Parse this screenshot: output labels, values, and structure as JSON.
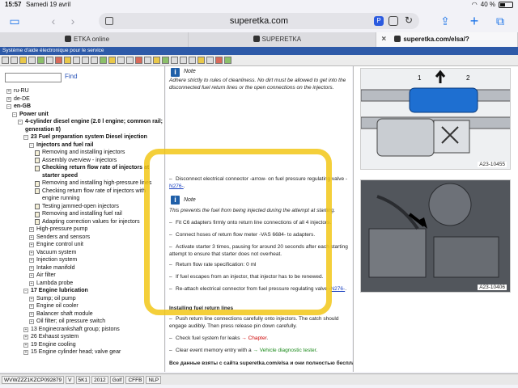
{
  "status": {
    "time": "15:57",
    "date": "Samedi 19 avril",
    "battery": "40 %"
  },
  "browser": {
    "url": "superetka.com",
    "tabs": [
      {
        "label": "ETKA online",
        "active": false
      },
      {
        "label": "SUPERETKA",
        "active": false
      },
      {
        "label": "superetka.com/elsa/?marke=V&modelljahr_num...",
        "active": true
      }
    ]
  },
  "app": {
    "title": "Système d'aide électronique pour le service",
    "find_label": "Find"
  },
  "tree": [
    {
      "label": "ru-RU",
      "toggle": "+",
      "indent": 0
    },
    {
      "label": "de-DE",
      "toggle": "+",
      "indent": 0
    },
    {
      "label": "en-GB",
      "toggle": "−",
      "indent": 0,
      "bold": true
    },
    {
      "label": "Power unit",
      "toggle": "−",
      "indent": 1,
      "bold": true
    },
    {
      "label": "4-cylinder diesel engine (2.0 l engine; common rail;",
      "toggle": "−",
      "indent": 2,
      "bold": true
    },
    {
      "label": "generation II)",
      "indent": 2,
      "bold": true,
      "cont": true
    },
    {
      "label": "23 Fuel preparation system Diesel injection",
      "toggle": "−",
      "indent": 3,
      "bold": true
    },
    {
      "label": "Injectors and fuel rail",
      "toggle": "−",
      "indent": 4,
      "bold": true
    },
    {
      "label": "Removing and installing injectors",
      "doc": true,
      "indent": 5
    },
    {
      "label": "Assembly overview - injectors",
      "doc": true,
      "indent": 5
    },
    {
      "label": "Checking return flow rate of injectors at",
      "doc": true,
      "indent": 5,
      "bold": true
    },
    {
      "label": "starter speed",
      "indent": 5,
      "bold": true,
      "cont": true
    },
    {
      "label": "Removing and installing high-pressure lines",
      "doc": true,
      "indent": 5
    },
    {
      "label": "Checking return flow rate of injectors with",
      "doc": true,
      "indent": 5
    },
    {
      "label": "engine running",
      "indent": 5,
      "cont": true
    },
    {
      "label": "Testing jammed-open injectors",
      "doc": true,
      "indent": 5
    },
    {
      "label": "Removing and installing fuel rail",
      "doc": true,
      "indent": 5
    },
    {
      "label": "Adapting correction values for injectors",
      "doc": true,
      "indent": 5
    },
    {
      "label": "High-pressure pump",
      "toggle": "+",
      "indent": 4
    },
    {
      "label": "Senders and sensors",
      "toggle": "+",
      "indent": 4
    },
    {
      "label": "Engine control unit",
      "toggle": "+",
      "indent": 4
    },
    {
      "label": "Vacuum system",
      "toggle": "+",
      "indent": 4
    },
    {
      "label": "Injection system",
      "toggle": "+",
      "indent": 4
    },
    {
      "label": "Intake manifold",
      "toggle": "+",
      "indent": 4
    },
    {
      "label": "Air filter",
      "toggle": "+",
      "indent": 4
    },
    {
      "label": "Lambda probe",
      "toggle": "+",
      "indent": 4
    },
    {
      "label": "17 Engine lubrication",
      "toggle": "−",
      "indent": 3,
      "bold": true
    },
    {
      "label": "Sump; oil pump",
      "toggle": "+",
      "indent": 4
    },
    {
      "label": "Engine oil cooler",
      "toggle": "+",
      "indent": 4
    },
    {
      "label": "Balancer shaft module",
      "toggle": "+",
      "indent": 4
    },
    {
      "label": "Oil filter; oil pressure switch",
      "toggle": "+",
      "indent": 4
    },
    {
      "label": "13 Enginecrankshaft group; pistons",
      "toggle": "+",
      "indent": 3
    },
    {
      "label": "26 Exhaust system",
      "toggle": "+",
      "indent": 3
    },
    {
      "label": "19 Engine cooling",
      "toggle": "+",
      "indent": 3
    },
    {
      "label": "15 Engine cylinder head; valve gear",
      "toggle": "+",
      "indent": 3
    }
  ],
  "content": {
    "note1_title": "Note",
    "note1_text": "Adhere strictly to rules of cleanliness. No dirt must be allowed to get into the disconnected fuel return lines or the open connections on the injectors.",
    "step_disconnect": "Disconnect electrical connector -arrow- on fuel pressure regulating valve -",
    "step_disconnect_link": "N276-",
    "step_disconnect_end": ".",
    "note2_title": "Note",
    "note2_text": "This prevents the fuel from being injected during the attempt at starting.",
    "steps": [
      "Fit C6 adapters firmly onto return line connections of all 4 injectors.",
      "Connect hoses of return flow meter -VAS 6684- to adapters.",
      "Activate starter 3 times, pausing for around 20 seconds after each starting attempt to ensure that starter does not overheat.",
      "Return flow rate specification: 0 ml",
      "If fuel escapes from an injector, that injector has to be renewed."
    ],
    "step_reattach": "Re-attach electrical connector from fuel pressure regulating valve -",
    "step_reattach_link": "N276-",
    "step_reattach_end": ".",
    "heading_return_lines": "Installing fuel return lines",
    "step_push": "Push return line connections carefully onto injectors. The catch should engage audibly. Then press release pin down carefully.",
    "step_check_prefix": "Check fuel system for leaks ",
    "step_check_arrow": "→ ",
    "step_check_link": "Chapter",
    "step_check_end": ".",
    "step_clear_prefix": "Clear event memory entry with a ",
    "step_clear_arrow": "→ ",
    "step_clear_link": "Vehicle diagnostic tester",
    "step_clear_end": ".",
    "footer_ru": "Все данные взяты с сайта superetka.com/elsa и они полностью бесплатны"
  },
  "figures": [
    {
      "label": "A23-10455",
      "callouts": [
        "1",
        "2"
      ]
    },
    {
      "label": "A23-10406"
    }
  ],
  "statusline": [
    "WVWZZZ1KZCP092879",
    "V",
    "5K1",
    "2012",
    "Golf",
    "CFFB",
    "NLP"
  ],
  "colors": {
    "accent": "#1a73e8",
    "highlight": "#f1c40f",
    "app_title_bar": "#2e5aa8",
    "connector_blue": "#1e6fd1"
  }
}
